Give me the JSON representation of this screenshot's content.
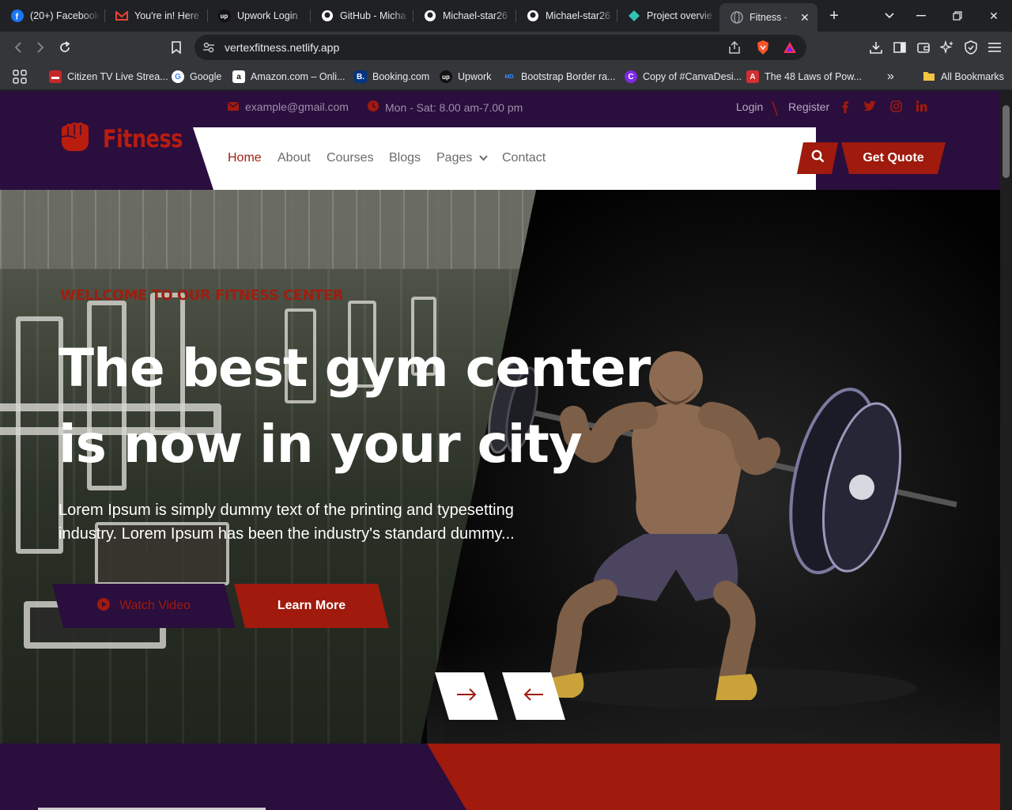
{
  "browser": {
    "tabs": [
      {
        "title": "(20+) Facebook",
        "icon": "facebook-icon",
        "color": "#1877f2"
      },
      {
        "title": "You're in! Here",
        "icon": "gmail-icon",
        "color": "#ea4335"
      },
      {
        "title": "Upwork Login",
        "icon": "upwork-icon",
        "color": "#111111"
      },
      {
        "title": "GitHub - Micha",
        "icon": "github-icon",
        "color": "#ffffff"
      },
      {
        "title": "Michael-star26",
        "icon": "github-icon",
        "color": "#ffffff"
      },
      {
        "title": "Michael-star26",
        "icon": "github-icon",
        "color": "#ffffff"
      },
      {
        "title": "Project overvie",
        "icon": "netlify-icon",
        "color": "#32c3b4"
      },
      {
        "title": "Fitness - Fi",
        "icon": "globe-icon",
        "color": "#9aa0a6"
      }
    ],
    "url": "vertexfitness.netlify.app",
    "bookmarks": [
      {
        "label": "Citizen TV Live Strea...",
        "color": "#c62828",
        "glyph": "▬"
      },
      {
        "label": "Google",
        "color": "#ffffff",
        "glyph": "G"
      },
      {
        "label": "Amazon.com – Onli...",
        "color": "#ffffff",
        "glyph": "a"
      },
      {
        "label": "Booking.com",
        "color": "#003580",
        "glyph": "B."
      },
      {
        "label": "Upwork",
        "color": "#111111",
        "glyph": "up"
      },
      {
        "label": "Bootstrap Border ra...",
        "color": "#35363a",
        "glyph": "MD"
      },
      {
        "label": "Copy of #CanvaDesi...",
        "color": "#7d2ae8",
        "glyph": "C"
      },
      {
        "label": "The 48 Laws of Pow...",
        "color": "#d32f2f",
        "glyph": "A"
      }
    ],
    "all_bookmarks": "All Bookmarks"
  },
  "site": {
    "email": "example@gmail.com",
    "hours": "Mon - Sat: 8.00 am-7.00 pm",
    "login": "Login",
    "register": "Register",
    "logo": "Fitness",
    "nav": [
      "Home",
      "About",
      "Courses",
      "Blogs",
      "Pages",
      "Contact"
    ],
    "quote": "Get Quote",
    "accent_color": "#a01a0d",
    "purple": "#2a0e3e"
  },
  "hero": {
    "eyebrow": "Wellcome to our fitness center",
    "title_line1": "The best gym center",
    "title_line2": "is now in your city",
    "text_line1": "Lorem Ipsum is simply dummy text of the printing and typesetting",
    "text_line2": "industry. Lorem Ipsum has been the industry's standard dummy...",
    "watch": "Watch Video",
    "learn": "Learn More"
  }
}
